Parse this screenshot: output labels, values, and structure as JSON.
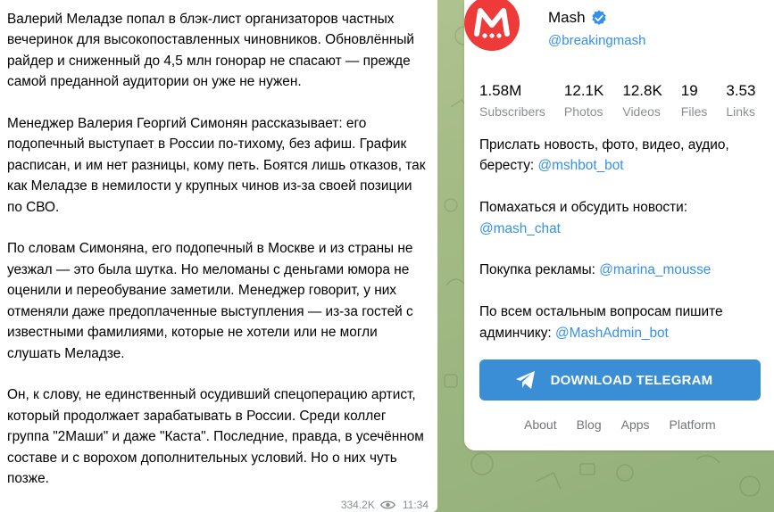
{
  "post": {
    "text": "Валерий Меладзе попал в блэк-лист организаторов частных вечеринок для высокопоставленных чиновников. Обновлённый райдер и сниженный до 4,5 млн гонорар не спасают — прежде самой преданной аудитории он уже не нужен.\n\nМенеджер Валерия Георгий Симонян рассказывает: его подопечный выступает в России по-тихому, без афиш. График расписан, и им нет разницы, кому петь. Боятся лишь отказов, так как Меладзе в немилости у крупных чинов из-за своей позиции по СВО.\n\nПо словам Симоняна, его подопечный в Москве и из страны не уезжал — это была шутка. Но меломаны с деньгами юмора не оценили и переобувание заметили. Менеджер говорит, у них отменяли даже предоплаченные выступления — из-за гостей с известными фамилиями, которые не хотели или не могли слушать Меладзе.\n\nОн, к слову, не единственный осудивший спецоперацию артист, который продолжает зарабатывать в России. Среди коллег группа \"2Маши\" и даже \"Каста\". Последние, правда, в усечённом составе и с ворохом дополнительных условий. Но о них чуть позже.",
    "views": "334.2K",
    "time": "11:34",
    "view_icon": "eye-icon"
  },
  "channel": {
    "name": "Mash",
    "handle": "@breakingmash",
    "avatar_letter": "M",
    "avatar_color": "#ef3a3a",
    "verified_icon": "verified-badge-icon",
    "stats": [
      {
        "value": "1.58M",
        "label": "Subscribers"
      },
      {
        "value": "12.1K",
        "label": "Photos"
      },
      {
        "value": "12.8K",
        "label": "Videos"
      },
      {
        "value": "19",
        "label": "Files"
      },
      {
        "value": "3.53",
        "label": "Links"
      }
    ],
    "desc": {
      "p1_text": "Прислать новость, фото, видео, аудио, бересту: ",
      "p1_link": "@mshbot_bot",
      "p2_text": "Помахаться и обсудить новости: ",
      "p2_link": "@mash_chat",
      "p3_text": "Покупка рекламы: ",
      "p3_link": "@marina_mousse",
      "p4_text": "По всем остальным вопросам пишите админчику: ",
      "p4_link": "@MashAdmin_bot"
    },
    "download_label": "DOWNLOAD TELEGRAM",
    "accent_color": "#3a8ed6",
    "link_color": "#3390ec"
  },
  "footer": {
    "links": [
      "About",
      "Blog",
      "Apps",
      "Platform"
    ]
  }
}
